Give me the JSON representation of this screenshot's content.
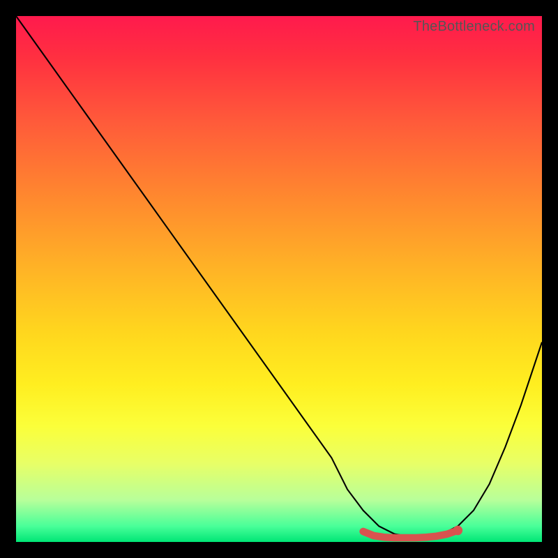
{
  "watermark": "TheBottleneck.com",
  "chart_data": {
    "type": "line",
    "title": "",
    "xlabel": "",
    "ylabel": "",
    "xlim": [
      0,
      100
    ],
    "ylim": [
      0,
      100
    ],
    "grid": false,
    "legend": false,
    "series": [
      {
        "name": "bottleneck-curve",
        "color": "#000000",
        "x": [
          0,
          5,
          10,
          15,
          20,
          25,
          30,
          35,
          40,
          45,
          50,
          55,
          60,
          63,
          66,
          69,
          72,
          75,
          78,
          81,
          84,
          87,
          90,
          93,
          96,
          100
        ],
        "values": [
          100,
          93,
          86,
          79,
          72,
          65,
          58,
          51,
          44,
          37,
          30,
          23,
          16,
          10,
          6,
          3,
          1.5,
          1,
          1,
          1.5,
          3,
          6,
          11,
          18,
          26,
          38
        ]
      },
      {
        "name": "optimal-range-marker",
        "color": "#d9534f",
        "x": [
          66,
          68,
          70,
          72,
          74,
          76,
          78,
          80,
          82,
          84
        ],
        "values": [
          2.0,
          1.2,
          0.9,
          0.8,
          0.8,
          0.8,
          0.9,
          1.1,
          1.5,
          2.2
        ]
      }
    ],
    "annotations": []
  },
  "colors": {
    "frame": "#000000",
    "curve": "#000000",
    "marker": "#d9534f",
    "watermark": "#555555"
  }
}
